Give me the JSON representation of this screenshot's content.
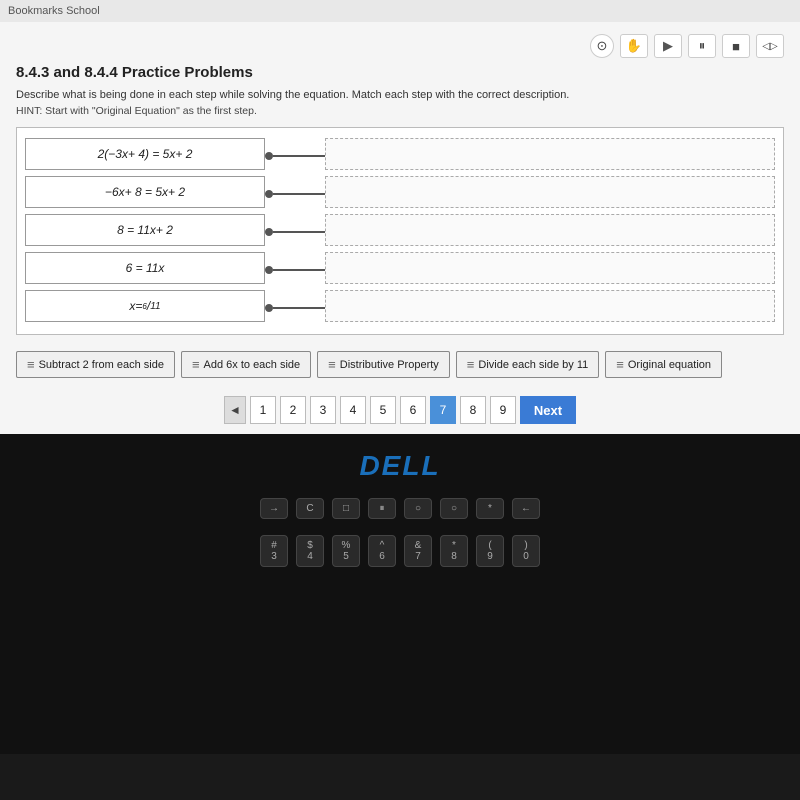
{
  "browser": {
    "breadcrumb": "Bookmarks  School"
  },
  "header": {
    "title": "8.4.3 and 8.4.4 Practice Problems"
  },
  "toolbar": {
    "buttons": [
      {
        "label": "⊙",
        "name": "circle-btn"
      },
      {
        "label": "✋",
        "name": "hand-btn"
      },
      {
        "label": "▶",
        "name": "play-btn"
      },
      {
        "label": "⏸",
        "name": "pause-btn"
      },
      {
        "label": "■",
        "name": "stop-btn"
      },
      {
        "label": "◁▷",
        "name": "settings-btn"
      }
    ]
  },
  "instructions": {
    "main": "Describe what is being done in each step while solving the equation.  Match each step with the correct description.",
    "hint": "HINT:  Start with \"Original Equation\" as the first step."
  },
  "equations": [
    {
      "id": "eq1",
      "text": "2(−3x + 4) = 5x + 2"
    },
    {
      "id": "eq2",
      "text": "−6x + 8 = 5x + 2"
    },
    {
      "id": "eq3",
      "text": "8 = 11x + 2"
    },
    {
      "id": "eq4",
      "text": "6 = 11x"
    },
    {
      "id": "eq5",
      "text": "x = 6/11"
    }
  ],
  "choices": [
    {
      "label": "Subtract 2 from each side",
      "name": "choice-subtract"
    },
    {
      "label": "Add 6x to each side",
      "name": "choice-add6x"
    },
    {
      "label": "Distributive Property",
      "name": "choice-distributive"
    },
    {
      "label": "Divide each side by 11",
      "name": "choice-divide"
    },
    {
      "label": "Original equation",
      "name": "choice-original"
    }
  ],
  "pagination": {
    "pages": [
      "1",
      "2",
      "3",
      "4",
      "5",
      "6",
      "7",
      "8",
      "9"
    ],
    "active_page": "7",
    "prev_label": "◄",
    "next_label": "Next"
  },
  "dell_logo": "DELL",
  "keyboard": {
    "row1": [
      "→",
      "C",
      "□",
      "□II",
      "○",
      "○",
      "*",
      "←"
    ],
    "row2": [
      "#3",
      "$4",
      "%5",
      "^6",
      "&7",
      "*8",
      "(9",
      ")0"
    ]
  }
}
